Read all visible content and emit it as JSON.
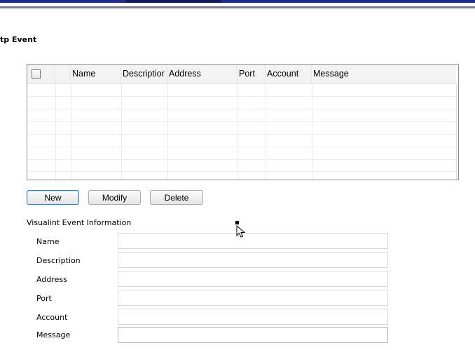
{
  "page": {
    "title": "tp Event"
  },
  "table": {
    "columns": [
      "Name",
      "Descriptior",
      "Address",
      "Port",
      "Account",
      "Message"
    ],
    "rows": [
      {
        "name": "",
        "description": "",
        "address": "",
        "port": "",
        "account": "",
        "message": ""
      },
      {
        "name": "",
        "description": "",
        "address": "",
        "port": "",
        "account": "",
        "message": ""
      },
      {
        "name": "",
        "description": "",
        "address": "",
        "port": "",
        "account": "",
        "message": ""
      },
      {
        "name": "",
        "description": "",
        "address": "",
        "port": "",
        "account": "",
        "message": ""
      },
      {
        "name": "",
        "description": "",
        "address": "",
        "port": "",
        "account": "",
        "message": ""
      },
      {
        "name": "",
        "description": "",
        "address": "",
        "port": "",
        "account": "",
        "message": ""
      },
      {
        "name": "",
        "description": "",
        "address": "",
        "port": "",
        "account": "",
        "message": ""
      },
      {
        "name": "",
        "description": "",
        "address": "",
        "port": "",
        "account": "",
        "message": ""
      }
    ]
  },
  "actions": {
    "new_label": "New",
    "modify_label": "Modify",
    "delete_label": "Delete"
  },
  "info": {
    "title": "Visualint Event Information",
    "fields": [
      {
        "label": "Name",
        "value": ""
      },
      {
        "label": "Description",
        "value": ""
      },
      {
        "label": "Address",
        "value": ""
      },
      {
        "label": "Port",
        "value": ""
      },
      {
        "label": "Account",
        "value": ""
      },
      {
        "label": "Message",
        "value": ""
      }
    ]
  },
  "colors": {
    "title_bar": "#1b2c8a",
    "primary_button_border": "#3c7fb1",
    "table_border": "#8f8f8f"
  }
}
